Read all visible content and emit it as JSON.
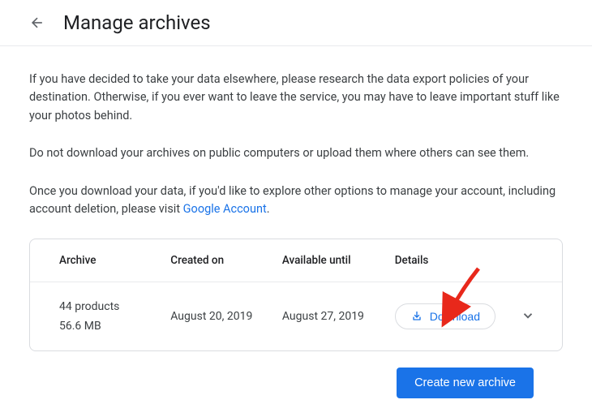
{
  "header": {
    "title": "Manage archives"
  },
  "intro": {
    "p1": "If you have decided to take your data elsewhere, please research the data export policies of your destination. Otherwise, if you ever want to leave the service, you may have to leave important stuff like your photos behind.",
    "p2": "Do not download your archives on public computers or upload them where others can see them.",
    "p3_prefix": "Once you download your data, if you'd like to explore other options to manage your account, including account deletion, please visit ",
    "p3_link": "Google Account",
    "p3_suffix": "."
  },
  "table": {
    "headers": {
      "archive": "Archive",
      "created": "Created on",
      "available": "Available until",
      "details": "Details"
    },
    "row": {
      "products": "44 products",
      "size": "56.6 MB",
      "created": "August 20, 2019",
      "available": "August 27, 2019",
      "download_label": "Download"
    }
  },
  "footer": {
    "create_label": "Create new archive"
  }
}
